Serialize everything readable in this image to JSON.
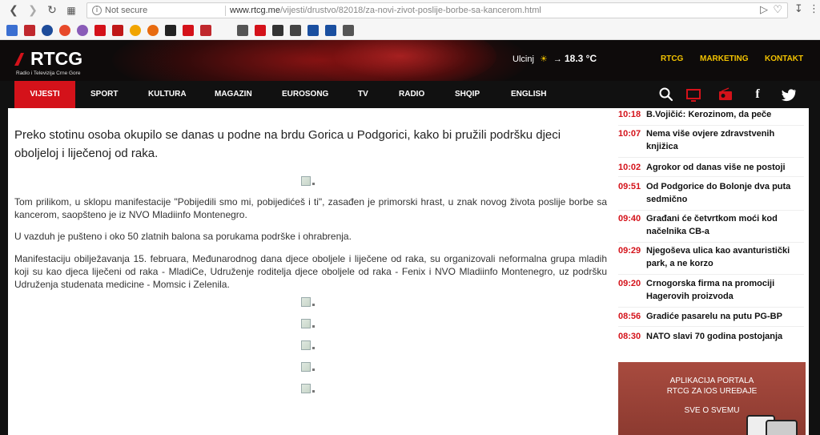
{
  "browser": {
    "security": "Not secure",
    "url_host": "www.rtcg.me",
    "url_path": "/vijesti/drustvo/82018/za-novi-zivot-poslije-borbe-sa-kancerom.html",
    "nav_icons": [
      "back-arrow-icon",
      "forward-arrow-icon",
      "reload-icon",
      "grid-icon"
    ]
  },
  "header": {
    "logo_name": "RTCG",
    "logo_tagline": "Radio i Televizija Crne Gore",
    "weather_city": "Ulcinj",
    "weather_temp": "18.3 °C",
    "links": [
      "RTCG",
      "MARKETING",
      "KONTAKT"
    ],
    "accent": "#d4121a",
    "link_color": "#f2c200"
  },
  "nav": {
    "items": [
      "VIJESTI",
      "SPORT",
      "KULTURA",
      "MAGAZIN",
      "EUROSONG",
      "TV",
      "RADIO",
      "SHQIP",
      "ENGLISH"
    ],
    "active": "VIJESTI",
    "icons": [
      "search-icon",
      "tv-icon",
      "radio-icon",
      "facebook-icon",
      "twitter-icon"
    ]
  },
  "article": {
    "lead": "Preko stotinu osoba okupilo se danas u podne na brdu Gorica u Podgorici, kako bi pružili podršku djeci oboljeloj i liječenoj od raka.",
    "paragraphs": [
      "Tom prilikom, u sklopu manifestacije \"Pobijedili smo mi, pobijedićeš i ti\", zasađen je primorski hrast, u znak novog života poslije borbe sa kancerom, saopšteno je iz NVO Mladiinfo Montenegro.",
      "U vazduh je pušteno i oko 50 zlatnih balona sa porukama podrške i ohrabrenja.",
      "Manifestaciju obilježavanja 15. februara, Međunarodnog dana djece oboljele i liječene od raka, su organizovali neformalna grupa mladih koji su kao djeca liječeni od raka - MladiCe, Udruženje roditelja djece oboljele od raka - Fenix i NVO Mladiinfo Montenegro, uz podršku Udruženja studenata medicine - Momsic i Zelenila."
    ]
  },
  "sidebar": {
    "news": [
      {
        "time": "10:18",
        "title": "B.Vojičić: Kerozinom, da peče"
      },
      {
        "time": "10:07",
        "title": "Nema više ovjere zdravstvenih knjižica"
      },
      {
        "time": "10:02",
        "title": "Agrokor od danas više ne postoji"
      },
      {
        "time": "09:51",
        "title": "Od Podgorice do Bolonje dva puta sedmično"
      },
      {
        "time": "09:40",
        "title": "Građani će četvrtkom moći kod načelnika CB-a"
      },
      {
        "time": "09:29",
        "title": "Njegoševa ulica kao avanturistički park, a ne korzo"
      },
      {
        "time": "09:20",
        "title": "Crnogorska firma na promociji Hagerovih proizvoda"
      },
      {
        "time": "08:56",
        "title": "Gradiće pasarelu na putu PG-BP"
      },
      {
        "time": "08:30",
        "title": "NATO slavi 70 godina postojanja"
      }
    ],
    "promo": {
      "line1": "APLIKACIJA PORTALA",
      "line2": "RTCG ZA IOS UREĐAJE",
      "line3": "SVE O SVEMU"
    }
  }
}
